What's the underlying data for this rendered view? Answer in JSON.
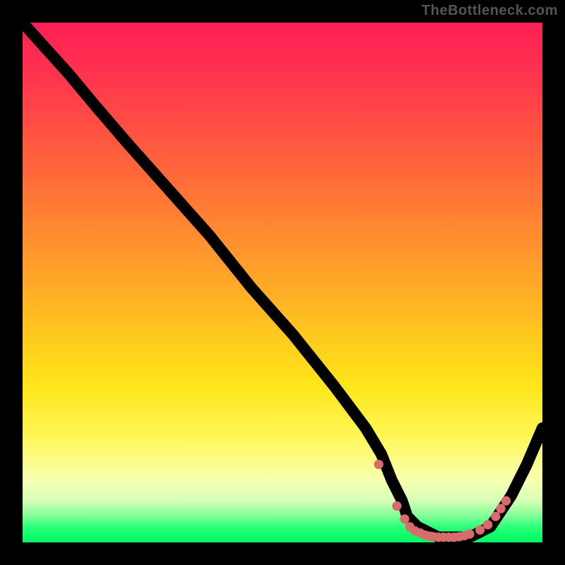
{
  "watermark": "TheBottleneck.com",
  "chart_data": {
    "type": "line",
    "title": "",
    "xlabel": "",
    "ylabel": "",
    "xlim": [
      0,
      100
    ],
    "ylim": [
      0,
      100
    ],
    "grid": false,
    "legend": false,
    "series": [
      {
        "name": "bottleneck-curve",
        "x": [
          0,
          9,
          14,
          20,
          28,
          36,
          44,
          52,
          60,
          66,
          69,
          71,
          73,
          74,
          76,
          78,
          80,
          82,
          84,
          86,
          88,
          90,
          94,
          97,
          100
        ],
        "y": [
          100,
          90,
          84,
          77,
          68,
          59,
          49,
          40,
          30,
          22,
          17,
          12,
          8,
          5,
          3,
          2,
          1,
          1,
          1,
          1,
          2,
          3,
          9,
          15,
          22
        ]
      }
    ],
    "markers": {
      "name": "valley-dots",
      "x": [
        68.5,
        72.0,
        73.5,
        74.5,
        75.5,
        76.5,
        77.5,
        78.3,
        79.0,
        80.0,
        81.0,
        82.0,
        83.0,
        84.0,
        85.0,
        86.0,
        88.0,
        89.5,
        91.0,
        92.0,
        93.0
      ],
      "y": [
        15.0,
        7.0,
        4.5,
        3.0,
        2.2,
        1.8,
        1.4,
        1.2,
        1.1,
        1.0,
        1.0,
        1.0,
        1.0,
        1.1,
        1.3,
        1.6,
        2.4,
        3.4,
        5.0,
        6.5,
        8.0
      ]
    }
  }
}
